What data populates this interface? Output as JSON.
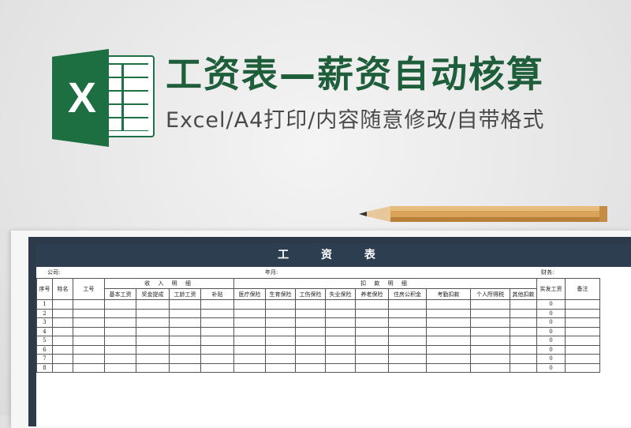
{
  "header": {
    "title": "工资表—薪资自动核算",
    "subtitle": "Excel/A4打印/内容随意修改/自带格式"
  },
  "logo": {
    "letter": "X",
    "icon": "excel-logo-icon",
    "color": "#1d6f42"
  },
  "sheet": {
    "title": "工  资  表",
    "company_label": "公司:",
    "period_label": "年月:",
    "finance_label": "财务:",
    "headers": {
      "seq": "序号",
      "name": "姓名",
      "job_no": "工号",
      "income_group": "收 入 明 细",
      "deduct_group": "扣 款 明 细",
      "net_pay": "实发工资",
      "remark": "备注",
      "income_cols": [
        "基本工资",
        "奖金提成",
        "工龄工资",
        "补贴"
      ],
      "deduct_cols": [
        "医疗保险",
        "生育保险",
        "工伤保险",
        "失业保险",
        "养老保险",
        "住房公积金",
        "考勤扣款",
        "个人所得税",
        "其他扣款"
      ]
    },
    "rows": [
      {
        "seq": "1",
        "net": "0"
      },
      {
        "seq": "2",
        "net": "0"
      },
      {
        "seq": "3",
        "net": "0"
      },
      {
        "seq": "4",
        "net": "0"
      },
      {
        "seq": "5",
        "net": "0"
      },
      {
        "seq": "6",
        "net": "0"
      },
      {
        "seq": "7",
        "net": "0"
      },
      {
        "seq": "8",
        "net": "0"
      }
    ]
  }
}
